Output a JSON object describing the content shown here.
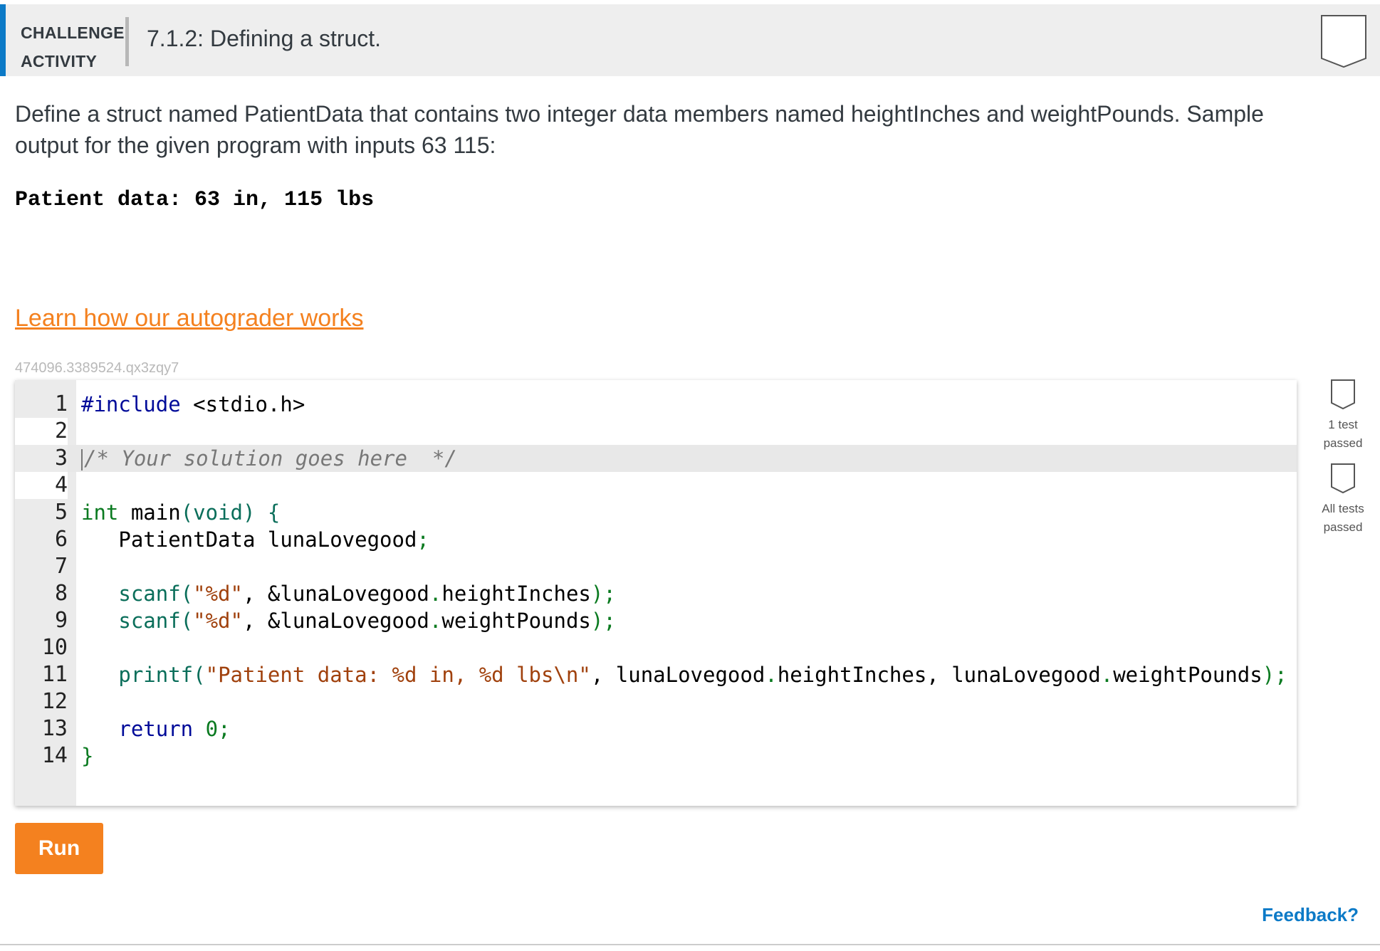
{
  "header": {
    "label_line1": "CHALLENGE",
    "label_line2": "ACTIVITY",
    "title": "7.1.2: Defining a struct."
  },
  "description": "Define a struct named PatientData that contains two integer data members named heightInches and weightPounds. Sample output for the given program with inputs 63 115:",
  "sample_output": "Patient data: 63 in, 115 lbs",
  "learn_link": "Learn how our autograder works",
  "activity_id": "474096.3389524.qx3zqy7",
  "code_lines": [
    {
      "n": "1"
    },
    {
      "n": "2"
    },
    {
      "n": "3"
    },
    {
      "n": "4"
    },
    {
      "n": "5"
    },
    {
      "n": "6"
    },
    {
      "n": "7"
    },
    {
      "n": "8"
    },
    {
      "n": "9"
    },
    {
      "n": "10"
    },
    {
      "n": "11"
    },
    {
      "n": "12"
    },
    {
      "n": "13"
    },
    {
      "n": "14"
    }
  ],
  "code": {
    "l1_kw": "#include",
    "l1_rest": " <stdio.h>",
    "l3_comment": "/* Your solution goes here  */",
    "l5_type": "int",
    "l5_main": " main",
    "l5_paren": "(void) {",
    "l6_text": "   PatientData lunaLovegood",
    "l6_semi": ";",
    "l8_fn": "   scanf(",
    "l8_str": "\"%d\"",
    "l8_rest1": ", &lunaLovegood",
    "l8_dot": ".",
    "l8_member": "heightInches",
    "l8_end": ");",
    "l9_fn": "   scanf(",
    "l9_str": "\"%d\"",
    "l9_rest1": ", &lunaLovegood",
    "l9_dot": ".",
    "l9_member": "weightPounds",
    "l9_end": ");",
    "l11_fn": "   printf(",
    "l11_str": "\"Patient data: %d in, %d lbs\\n\"",
    "l11_c1": ", ",
    "l11_v1": "lunaLovegood",
    "l11_d1": ".",
    "l11_m1": "heightInches",
    "l11_c2": ", ",
    "l11_v2": "lunaLovegood",
    "l11_d2": ".",
    "l11_m2": "weightPounds",
    "l11_end": ");",
    "l13_kw": "   return",
    "l13_num": " 0",
    "l13_semi": ";",
    "l14_brace": "}"
  },
  "status": {
    "test1_line1": "1 test",
    "test1_line2": "passed",
    "all_line1": "All tests",
    "all_line2": "passed"
  },
  "run_label": "Run",
  "feedback_label": "Feedback?",
  "colors": {
    "accent_blue": "#0c7ac7",
    "accent_orange": "#f4811f"
  }
}
